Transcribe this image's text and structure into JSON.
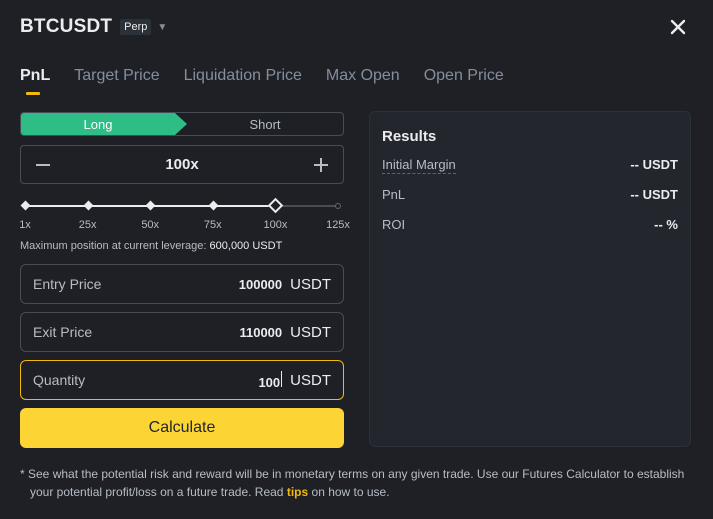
{
  "header": {
    "symbol": "BTCUSDT",
    "badge": "Perp"
  },
  "tabs": [
    {
      "label": "PnL"
    },
    {
      "label": "Target Price"
    },
    {
      "label": "Liquidation Price"
    },
    {
      "label": "Max Open"
    },
    {
      "label": "Open Price"
    }
  ],
  "side": {
    "long": "Long",
    "short": "Short",
    "selected": "Long"
  },
  "leverage": {
    "value": "100x",
    "current": 100,
    "max": 125,
    "ticks": [
      "1x",
      "25x",
      "50x",
      "75x",
      "100x",
      "125x"
    ],
    "tick_values": [
      1,
      25,
      50,
      75,
      100,
      125
    ]
  },
  "max_position": {
    "label": "Maximum position at current leverage:",
    "value": "600,000 USDT"
  },
  "fields": {
    "entry": {
      "label": "Entry Price",
      "value": "100000",
      "unit": "USDT"
    },
    "exit": {
      "label": "Exit Price",
      "value": "110000",
      "unit": "USDT"
    },
    "quantity": {
      "label": "Quantity",
      "value": "100",
      "unit": "USDT"
    }
  },
  "calculate_label": "Calculate",
  "results": {
    "title": "Results",
    "rows": [
      {
        "label": "Initial Margin",
        "value": "-- USDT"
      },
      {
        "label": "PnL",
        "value": "-- USDT"
      },
      {
        "label": "ROI",
        "value": "-- %"
      }
    ]
  },
  "footnote": {
    "line1": "* See what the potential risk and reward will be in monetary terms on any given trade. Use our Futures Calculator to establish",
    "line2_pre": "your potential profit/loss on a future trade. Read",
    "tips": "tips",
    "line2_post": "on how to use."
  },
  "colors": {
    "accent": "#f0b90b",
    "long": "#2ebd85",
    "button": "#fcd535",
    "background": "#1e2026"
  }
}
